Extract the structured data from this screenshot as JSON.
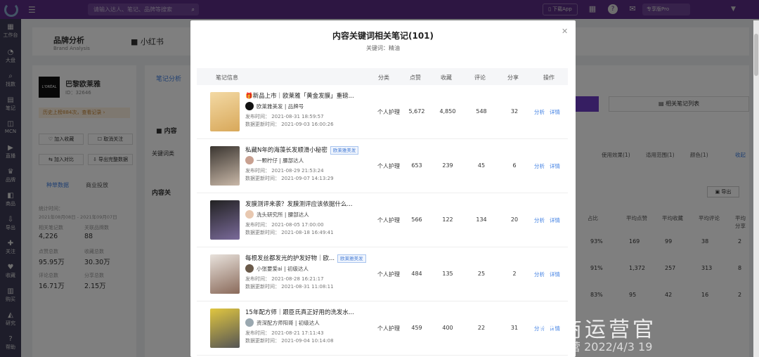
{
  "topbar": {
    "search_placeholder": "请输入达人、笔记、品牌等搜索",
    "download_app": "下载App",
    "version": "专享版Pro"
  },
  "sidebar": {
    "items": [
      {
        "icon": "grid-icon",
        "label": "工作台"
      },
      {
        "icon": "pie-icon",
        "label": "大盘"
      },
      {
        "icon": "find-icon",
        "label": "找数"
      },
      {
        "icon": "note-icon",
        "label": "笔记"
      },
      {
        "icon": "mcn-icon",
        "label": "MCN"
      },
      {
        "icon": "live-icon",
        "label": "直播"
      },
      {
        "icon": "brand-icon",
        "label": "品牌"
      },
      {
        "icon": "product-icon",
        "label": "商品"
      },
      {
        "icon": "export-icon",
        "label": "导出"
      },
      {
        "icon": "follow-icon",
        "label": "关注"
      },
      {
        "icon": "heart-icon",
        "label": "收藏"
      },
      {
        "icon": "buy-icon",
        "label": "购买"
      },
      {
        "icon": "research-icon",
        "label": "研究"
      },
      {
        "icon": "help-icon",
        "label": "帮助"
      }
    ]
  },
  "background": {
    "page_title": "品牌分析",
    "page_title_en": "Brand Analysis",
    "platform_tab": "小红书",
    "brand_name": "巴黎欧莱雅",
    "brand_id": "ID：32646",
    "history_notice": "历史上榜884次，查看记录 ›",
    "btn_add_fav": "加入收藏",
    "btn_unfollow": "取消关注",
    "btn_compare": "加入对比",
    "btn_export": "导出完整数据",
    "tab_seed": "种草数据",
    "tab_ads": "商业投放",
    "stats_period_label": "统计时间：",
    "stats_period": "2021年08月08日 - 2021年09月07日",
    "stats": [
      {
        "label": "相关笔记数",
        "value": "4,226"
      },
      {
        "label": "关联品牌数",
        "value": "88"
      },
      {
        "label": "点赞总数",
        "value": "95.95万"
      },
      {
        "label": "收藏总数",
        "value": "30.30万"
      },
      {
        "label": "评论总数",
        "value": "16.71万"
      },
      {
        "label": "分享总数",
        "value": "2.15万"
      }
    ],
    "section_tab": "笔记分析",
    "content_label": "内容",
    "content_heading": "内容关",
    "keyword_label": "关键词类",
    "related_notes_btn": "相关笔记列表",
    "filters": [
      "使用效果(1)",
      "适用范围(1)",
      "颜色(1)",
      "收起"
    ],
    "export_btn": "导出",
    "bg_table_headers": [
      "占比",
      "平均点赞",
      "平均收藏",
      "平均评论",
      "平均分享"
    ],
    "bg_rows": [
      [
        "93%",
        "169",
        "99",
        "38",
        "2"
      ],
      [
        "91%",
        "1,372",
        "257",
        "313",
        "8"
      ],
      [
        "83%",
        "95",
        "42",
        "16",
        "2"
      ]
    ]
  },
  "modal": {
    "title": "内容关键词相关笔记(101)",
    "keyword_line": "关键词：精油",
    "columns": [
      "笔记信息",
      "分类",
      "点赞",
      "收藏",
      "评论",
      "分享",
      "操作"
    ],
    "rows": [
      {
        "title": "🎁新品上市｜欧莱雅「黄金发膜」重磅...",
        "tag": "",
        "author": "欧莱雅美发",
        "author_type": "品牌号",
        "publish_time": "发布时间：  2021-08-31 18:59:57",
        "update_time": "数据更新时间：  2021-09-03 16:00:26",
        "category": "个人护理",
        "likes": "5,672",
        "collects": "4,850",
        "comments": "548",
        "shares": "32",
        "action_analyze": "分析",
        "action_detail": "详情"
      },
      {
        "title": "私藏N年的海藻长发顺滑小秘密",
        "tag": "欧莱雅美发",
        "author": "一颗柠仔",
        "author_type": "腰部达人",
        "publish_time": "发布时间：  2021-08-29 21:53:24",
        "update_time": "数据更新时间：  2021-09-07 14:13:29",
        "category": "个人护理",
        "likes": "653",
        "collects": "239",
        "comments": "45",
        "shares": "6",
        "action_analyze": "分析",
        "action_detail": "详情"
      },
      {
        "title": "发膜测评来袭？发膜测评应该依据什么...",
        "tag": "",
        "author": "洗头研究所",
        "author_type": "腰部达人",
        "publish_time": "发布时间：  2021-08-05 17:00:00",
        "update_time": "数据更新时间：  2021-08-18 16:49:41",
        "category": "个人护理",
        "likes": "566",
        "collects": "122",
        "comments": "134",
        "shares": "20",
        "action_analyze": "分析",
        "action_detail": "详情"
      },
      {
        "title": "每根发丝都发光的护发好物｜欧...",
        "tag": "欧莱雅美发",
        "author": "小张要爱ai",
        "author_type": "初级达人",
        "publish_time": "发布时间：  2021-08-28 16:21:17",
        "update_time": "数据更新时间：  2021-08-31 11:08:11",
        "category": "个人护理",
        "likes": "484",
        "collects": "135",
        "comments": "25",
        "shares": "2",
        "action_analyze": "分析",
        "action_detail": "详情"
      },
      {
        "title": "15年配方师｜跟臣氏真正好用的洗发水...",
        "tag": "",
        "author": "资深配方师阳哥",
        "author_type": "初级达人",
        "publish_time": "发布时间：  2021-08-21 17:11:43",
        "update_time": "数据更新时间：  2021-09-04 10:14:08",
        "category": "个人护理",
        "likes": "459",
        "collects": "400",
        "comments": "22",
        "shares": "31",
        "action_analyze": "分析",
        "action_detail": "详情"
      }
    ]
  },
  "watermark": {
    "main": "电商运营官",
    "sub": "电商运营 2022/4/3 19"
  }
}
